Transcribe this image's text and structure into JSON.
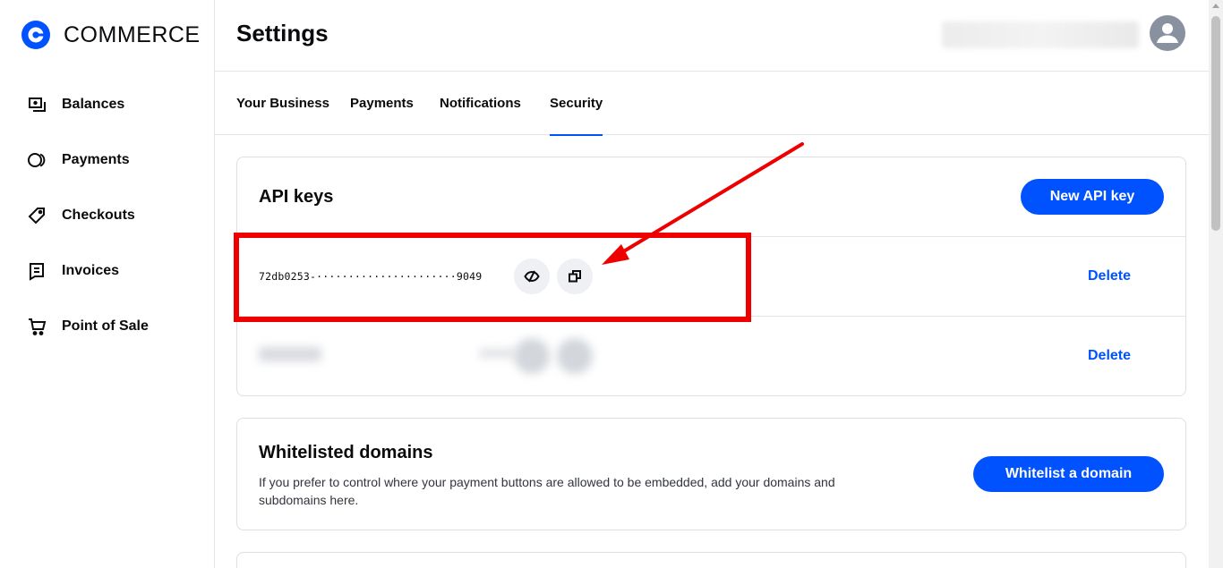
{
  "brand": {
    "name": "COMMERCE",
    "accent": "#0052ff"
  },
  "sidebar": {
    "items": [
      {
        "label": "Balances",
        "icon": "balances-icon"
      },
      {
        "label": "Payments",
        "icon": "payments-icon"
      },
      {
        "label": "Checkouts",
        "icon": "tag-icon"
      },
      {
        "label": "Invoices",
        "icon": "invoice-icon"
      },
      {
        "label": "Point of Sale",
        "icon": "cart-icon"
      }
    ]
  },
  "header": {
    "title": "Settings"
  },
  "tabs": [
    {
      "label": "Your Business"
    },
    {
      "label": "Payments"
    },
    {
      "label": "Notifications"
    },
    {
      "label": "Security",
      "active": true
    }
  ],
  "api_keys": {
    "title": "API keys",
    "new_button": "New API key",
    "keys": [
      {
        "masked": "72db0253-······················9049",
        "delete_label": "Delete"
      },
      {
        "delete_label": "Delete"
      }
    ]
  },
  "whitelisted": {
    "title": "Whitelisted domains",
    "description": "If you prefer to control where your payment buttons are allowed to be embedded, add your domains and subdomains here.",
    "button": "Whitelist a domain"
  },
  "annotation": {
    "color": "#ee0000"
  }
}
